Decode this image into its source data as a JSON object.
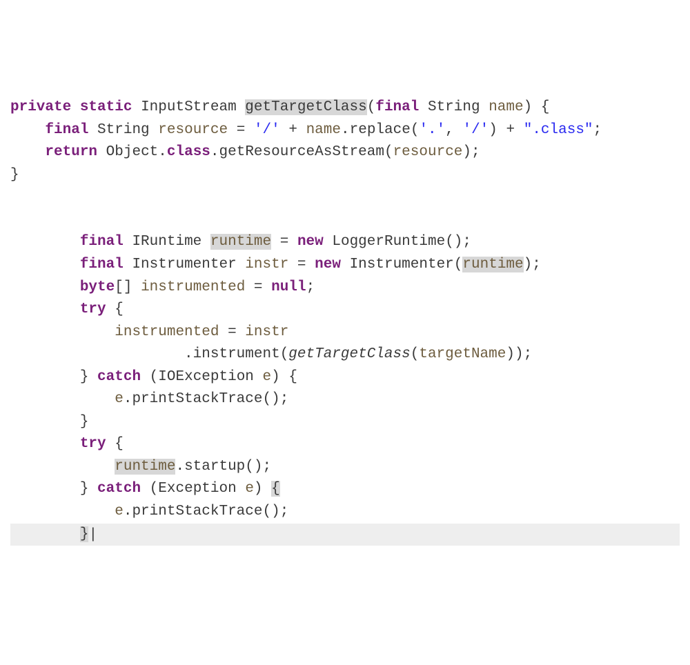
{
  "kw": {
    "private": "private",
    "static": "static",
    "final": "final",
    "return": "return",
    "new": "new",
    "byte": "byte",
    "null": "null",
    "try": "try",
    "catch": "catch"
  },
  "types": {
    "InputStream": "InputStream",
    "String": "String",
    "Object": "Object",
    "IRuntime": "IRuntime",
    "LoggerRuntime": "LoggerRuntime",
    "Instrumenter": "Instrumenter",
    "IOException": "IOException",
    "Exception": "Exception"
  },
  "names": {
    "getTargetClass": "getTargetClass",
    "name": "name",
    "resource": "resource",
    "replace": "replace",
    "class": "class",
    "getResourceAsStream": "getResourceAsStream",
    "runtime": "runtime",
    "instr": "instr",
    "instrumented": "instrumented",
    "instrument": "instrument",
    "targetName": "targetName",
    "e": "e",
    "printStackTrace": "printStackTrace",
    "startup": "startup"
  },
  "strings": {
    "slash": "'/'",
    "dot": "'.'",
    "slash2": "'/'",
    "dotclass": "\".class\""
  },
  "punct": {
    "lparen": "(",
    "rparen": ")",
    "lbrace": "{",
    "rbrace": "}",
    "lbracket": "[",
    "rbracket": "]",
    "semi": ";",
    "comma": ",",
    "dot": ".",
    "plus": "+",
    "eq": "=",
    "sp": " "
  },
  "ws": {
    "i1": "    ",
    "i2": "        ",
    "i3": "            ",
    "i4": "                    "
  }
}
